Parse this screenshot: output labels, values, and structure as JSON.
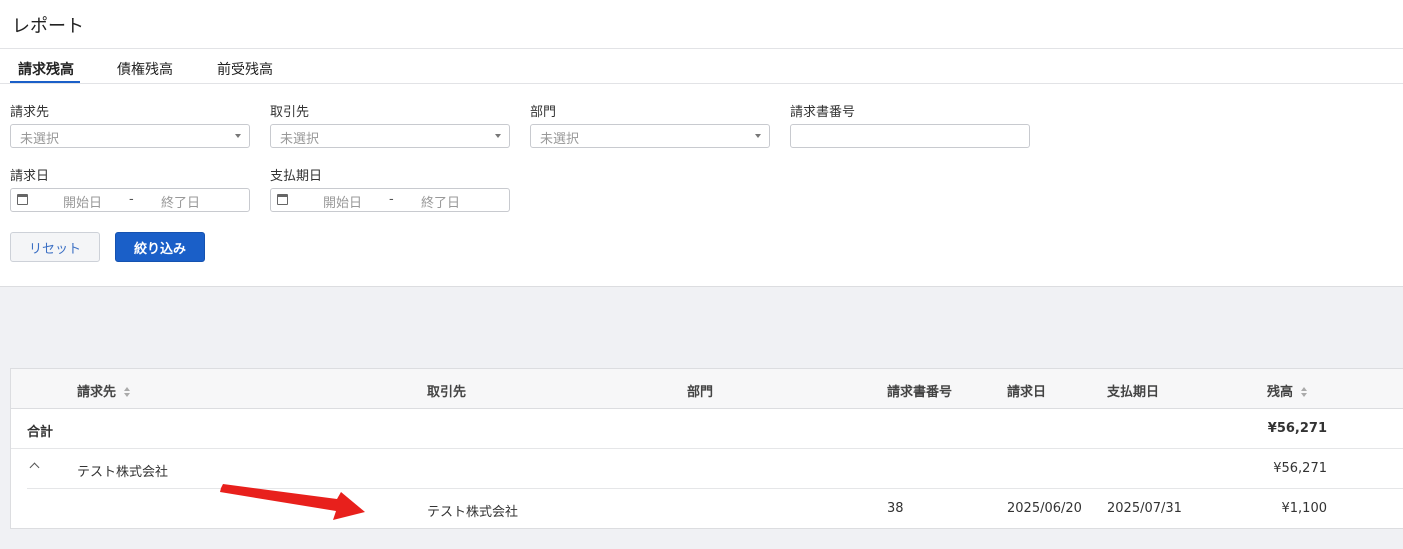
{
  "page": {
    "title": "レポート"
  },
  "tabs": [
    {
      "label": "請求残高",
      "active": true
    },
    {
      "label": "債権残高",
      "active": false
    },
    {
      "label": "前受残高",
      "active": false
    }
  ],
  "filters": {
    "billing_to": {
      "label": "請求先",
      "value": "未選択"
    },
    "partner": {
      "label": "取引先",
      "value": "未選択"
    },
    "department": {
      "label": "部門",
      "value": "未選択"
    },
    "invoice_number": {
      "label": "請求書番号",
      "value": ""
    },
    "invoice_date": {
      "label": "請求日",
      "start_placeholder": "開始日",
      "separator": "-",
      "end_placeholder": "終了日"
    },
    "due_date": {
      "label": "支払期日",
      "start_placeholder": "開始日",
      "separator": "-",
      "end_placeholder": "終了日"
    }
  },
  "buttons": {
    "reset": "リセット",
    "filter": "絞り込み"
  },
  "table": {
    "columns": [
      "請求先",
      "取引先",
      "部門",
      "請求書番号",
      "請求日",
      "支払期日",
      "残高"
    ],
    "total": {
      "label": "合計",
      "balance": "¥56,271"
    },
    "group": {
      "billing_to": "テスト株式会社",
      "balance": "¥56,271"
    },
    "rows": [
      {
        "partner": "テスト株式会社",
        "department": "",
        "invoice_number": "38",
        "invoice_date": "2025/06/20",
        "due_date": "2025/07/31",
        "balance": "¥1,100"
      }
    ]
  },
  "colors": {
    "accent": "#1a5fc8",
    "annotation_arrow": "#e8201c",
    "background": "#f0f1f4"
  },
  "icons": [
    "calendar-icon",
    "sort-icon",
    "chevron-up-icon",
    "dropdown-caret-icon",
    "red-arrow-annotation"
  ]
}
